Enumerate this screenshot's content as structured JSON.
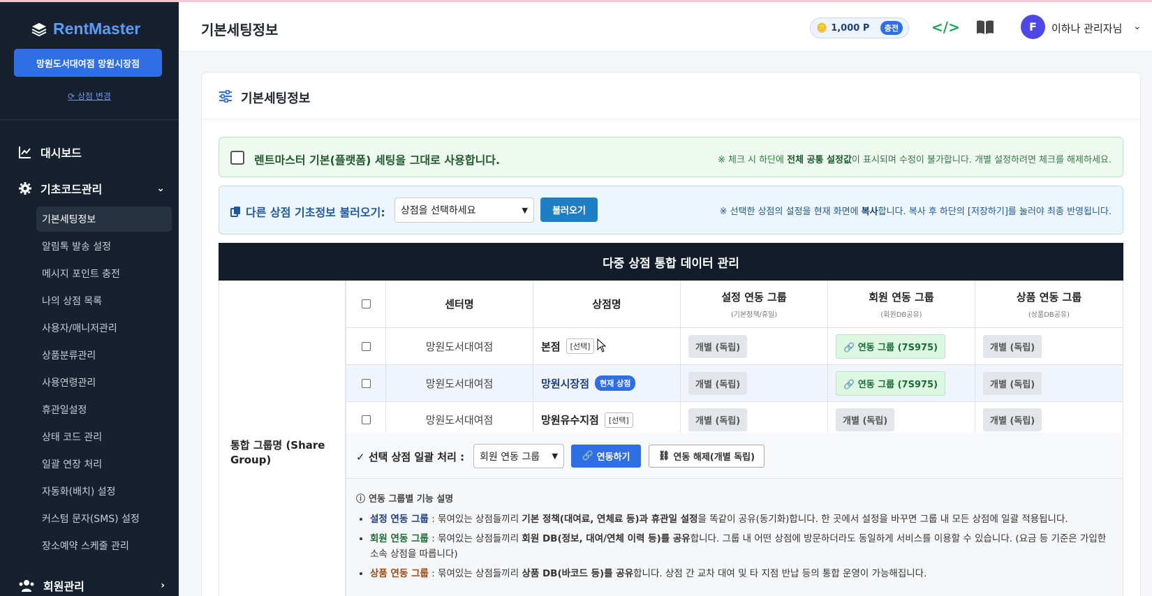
{
  "app": {
    "logo_text": "RentMaster",
    "store_button": "망원도서대여점 망원시장점",
    "change_store": "상점 변경"
  },
  "sidebar": {
    "dashboard": "대시보드",
    "basecode": "기초코드관리",
    "sub_items": [
      "기본세팅정보",
      "알림톡 발송 설정",
      "메시지 포인트 충전",
      "나의 상점 목록",
      "사용자/매니저관리",
      "상품분류관리",
      "사용연령관리",
      "휴관일설정",
      "상태 코드 관리",
      "일괄 연장 처리",
      "자동화(배치) 설정",
      "커스텀 문자(SMS) 설정",
      "장소예약 스케줄 관리"
    ],
    "member": "회원관리"
  },
  "header": {
    "title": "기본세팅정보",
    "points": "1,000 P",
    "charge": "충전",
    "avatar_letter": "F",
    "user_name": "이하나 관리자님"
  },
  "card": {
    "title": "기본세팅정보"
  },
  "platform": {
    "label": "렌트마스터 기본(플랫폼) 세팅을 그대로 사용합니다.",
    "note_pre": "※ 체크 시 하단에 ",
    "note_bold": "전체 공통 설정값",
    "note_post": "이 표시되며 수정이 불가합니다. 개별 설정하려면 체크를 해제하세요."
  },
  "load": {
    "label": "다른 상점 기초정보 불러오기:",
    "select_value": "상점을 선택하세요",
    "button": "불러오기",
    "note_pre": "※ 선택한 상점의 설정을 현재 화면에 ",
    "note_bold": "복사",
    "note_post": "합니다. 복사 후 하단의 [저장하기]를 눌러야 최종 반영됩니다."
  },
  "table": {
    "title": "다중 상점 통합 데이터 관리",
    "group_label": "통합 그룹명 (Share Group)",
    "headers": {
      "center": "센터명",
      "store": "상점명",
      "setting": "설정 연동 그룹",
      "setting_sub": "(기본정책/휴일)",
      "member": "회원 연동 그룹",
      "member_sub": "(회원DB공유)",
      "product": "상품 연동 그룹",
      "product_sub": "(상품DB공유)"
    },
    "rows": [
      {
        "center": "망원도서대여점",
        "store": "본점",
        "tag": "[선택]",
        "setting": "개별 (독립)",
        "member": "연동 그룹 (7S975)",
        "product": "개별 (독립)"
      },
      {
        "center": "망원도서대여점",
        "store": "망원시장점",
        "badge": "현재 상점",
        "setting": "개별 (독립)",
        "member": "연동 그룹 (7S975)",
        "product": "개별 (독립)"
      },
      {
        "center": "망원도서대여점",
        "store": "망원유수지점",
        "tag": "[선택]",
        "setting": "개별 (독립)",
        "member": "개별 (독립)",
        "product": "개별 (독립)"
      }
    ]
  },
  "bulk": {
    "label": "선택 상점 일괄 처리 :",
    "select_value": "회원 연동 그룹",
    "link": "연동하기",
    "unlink": "연동 해제(개별 독립)"
  },
  "desc": {
    "title": "연동 그룹별 기능 설명",
    "items": [
      {
        "key": "설정 연동 그룹",
        "a": " : 묶여있는 상점들끼리 ",
        "b": "기본 정책(대여료, 연체료 등)과 휴관일 설정",
        "c": "을 똑같이 공유(동기화)합니다. 한 곳에서 설정을 바꾸면 그룹 내 모든 상점에 일괄 적용됩니다."
      },
      {
        "key": "회원 연동 그룹",
        "a": " : 묶여있는 상점들끼리 ",
        "b": "회원 DB(정보, 대여/연체 이력 등)를 공유",
        "c": "합니다. 그룹 내 어떤 상점에 방문하더라도 동일하게 서비스를 이용할 수 있습니다. (요금 등 기준은 가입한 소속 상점을 따릅니다)"
      },
      {
        "key": "상품 연동 그룹",
        "a": " : 묶여있는 상점들끼리 ",
        "b": "상품 DB(바코드 등)를 공유",
        "c": "합니다. 상점 간 교차 대여 및 타 지점 반납 등의 통합 운영이 가능해집니다."
      }
    ]
  }
}
